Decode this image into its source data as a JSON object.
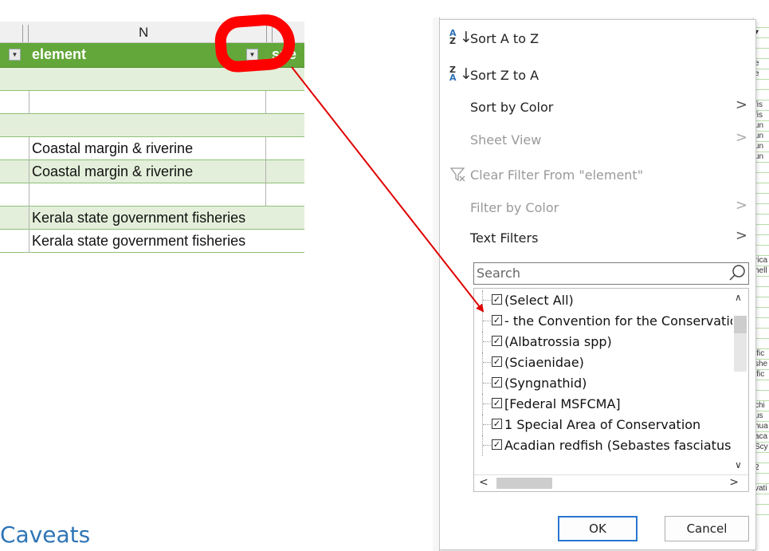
{
  "sheet": {
    "column_letter": "N",
    "header_label": "element",
    "header_next": "spe",
    "rows": [
      {
        "text": "",
        "shaded": true
      },
      {
        "text": "",
        "shaded": false
      },
      {
        "text": "",
        "shaded": true
      },
      {
        "text": "Coastal margin & riverine",
        "shaded": false
      },
      {
        "text": "Coastal margin & riverine",
        "shaded": true
      },
      {
        "text": "",
        "shaded": false
      },
      {
        "text": "Kerala state government fisheries",
        "shaded": true
      },
      {
        "text": "Kerala state government fisheries",
        "shaded": false
      }
    ]
  },
  "heading": "Caveats",
  "menu": {
    "sort_az": "Sort A to Z",
    "sort_za": "Sort Z to A",
    "sort_by_color": "Sort by Color",
    "sheet_view": "Sheet View",
    "clear_filter": "Clear Filter From \"element\"",
    "filter_by_color": "Filter by Color",
    "text_filters": "Text Filters",
    "search_placeholder": "Search",
    "list_items": [
      "(Select All)",
      "- the Convention for the Conservation",
      "(Albatrossia spp)",
      "(Sciaenidae)",
      "(Syngnathid)",
      "[Federal MSFCMA]",
      "1 Special Area of Conservation",
      "Acadian redfish (Sebastes fasciatus"
    ],
    "ok": "OK",
    "cancel": "Cancel"
  },
  "colors": {
    "header_green": "#63a73a",
    "annotation_red": "#ff0000",
    "heading_blue": "#2e75b6",
    "ok_border": "#2a76d0"
  }
}
